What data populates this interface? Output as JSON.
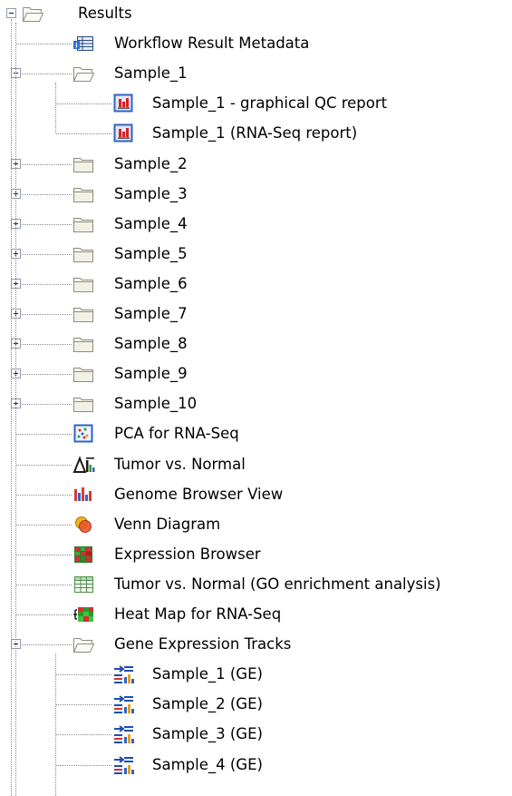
{
  "tree": {
    "root": {
      "label": "Results",
      "icon": "folder-open-icon"
    },
    "items": [
      {
        "label": "Workflow Result Metadata",
        "icon": "metadata-table-icon",
        "depth": 1
      },
      {
        "label": "Sample_1",
        "icon": "folder-open-icon",
        "depth": 1,
        "expanded": true
      },
      {
        "label": "Sample_1 - graphical QC report",
        "icon": "report-icon",
        "depth": 2
      },
      {
        "label": "Sample_1 (RNA-Seq report)",
        "icon": "report-icon",
        "depth": 2
      },
      {
        "label": "Sample_2",
        "icon": "folder-closed-icon",
        "depth": 1,
        "expanded": false
      },
      {
        "label": "Sample_3",
        "icon": "folder-closed-icon",
        "depth": 1,
        "expanded": false
      },
      {
        "label": "Sample_4",
        "icon": "folder-closed-icon",
        "depth": 1,
        "expanded": false
      },
      {
        "label": "Sample_5",
        "icon": "folder-closed-icon",
        "depth": 1,
        "expanded": false
      },
      {
        "label": "Sample_6",
        "icon": "folder-closed-icon",
        "depth": 1,
        "expanded": false
      },
      {
        "label": "Sample_7",
        "icon": "folder-closed-icon",
        "depth": 1,
        "expanded": false
      },
      {
        "label": "Sample_8",
        "icon": "folder-closed-icon",
        "depth": 1,
        "expanded": false
      },
      {
        "label": "Sample_9",
        "icon": "folder-closed-icon",
        "depth": 1,
        "expanded": false
      },
      {
        "label": "Sample_10",
        "icon": "folder-closed-icon",
        "depth": 1,
        "expanded": false
      },
      {
        "label": "PCA for RNA-Seq",
        "icon": "pca-plot-icon",
        "depth": 1
      },
      {
        "label": "Tumor vs. Normal",
        "icon": "statistics-icon",
        "depth": 1
      },
      {
        "label": "Genome Browser View",
        "icon": "genome-browser-icon",
        "depth": 1
      },
      {
        "label": "Venn Diagram",
        "icon": "venn-diagram-icon",
        "depth": 1
      },
      {
        "label": "Expression Browser",
        "icon": "expression-browser-icon",
        "depth": 1
      },
      {
        "label": "Tumor vs. Normal (GO enrichment analysis)",
        "icon": "table-icon",
        "depth": 1
      },
      {
        "label": "Heat Map for RNA-Seq",
        "icon": "heat-map-icon",
        "depth": 1
      },
      {
        "label": "Gene Expression Tracks",
        "icon": "folder-open-icon",
        "depth": 1,
        "expanded": true
      },
      {
        "label": "Sample_1 (GE)",
        "icon": "expression-track-icon",
        "depth": 2
      },
      {
        "label": "Sample_2 (GE)",
        "icon": "expression-track-icon",
        "depth": 2
      },
      {
        "label": "Sample_3 (GE)",
        "icon": "expression-track-icon",
        "depth": 2
      },
      {
        "label": "Sample_4 (GE)",
        "icon": "expression-track-icon",
        "depth": 2
      }
    ]
  },
  "colors": {
    "folder_fill": "#f3f1e6",
    "folder_stroke": "#8c8c80",
    "report_blue": "#2f63c6",
    "report_red": "#d82020",
    "connector": "#8a8a8a"
  }
}
